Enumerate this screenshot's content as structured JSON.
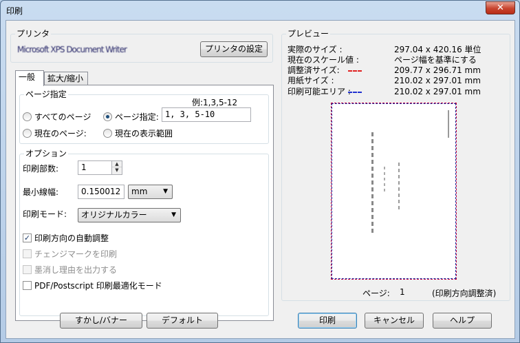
{
  "window": {
    "title": "印刷",
    "close_glyph": "✕"
  },
  "printer": {
    "group_label": "プリンタ",
    "name": "Microsoft XPS Document Writer",
    "settings_button": "プリンタの設定"
  },
  "tabs": [
    {
      "label": "一般",
      "active": true
    },
    {
      "label": "拡大/縮小",
      "active": false
    }
  ],
  "page_range": {
    "group_label": "ページ指定",
    "example": "例:1,3,5-12",
    "all_pages": "すべてのページ",
    "specify": "ページ指定:",
    "specify_value": "1, 3, 5-10",
    "current_page": "現在のページ:",
    "current_view": "現在の表示範囲",
    "selected": "specify"
  },
  "options": {
    "group_label": "オプション",
    "copies_label": "印刷部数:",
    "copies_value": "1",
    "min_line_label": "最小線幅:",
    "min_line_value": "0.150012",
    "min_line_unit": "mm",
    "mode_label": "印刷モード:",
    "mode_value": "オリジナルカラー",
    "auto_orient": "印刷方向の自動調整",
    "change_marks": "チェンジマークを印刷",
    "redaction_reason": "墨消し理由を出力する",
    "pdf_optimize": "PDF/Postscript 印刷最適化モード",
    "check_glyph": "✓"
  },
  "preview": {
    "group_label": "プレビュー",
    "rows": [
      {
        "label": "実際のサイズ :",
        "value": "297.04 x 420.16 単位"
      },
      {
        "label": "現在のスケール値 :",
        "value": "ページ幅を基準にする"
      },
      {
        "label": "調整済サイズ:",
        "value": "209.77 x 296.71 mm"
      },
      {
        "label": "用紙サイズ :",
        "value": "210.02 x 297.01 mm"
      },
      {
        "label": "印刷可能エリア :",
        "value": "210.02 x 297.01 mm"
      }
    ],
    "page_label": "ページ:",
    "page_value": "1",
    "orientation_note": "(印刷方向調整済)",
    "adjusted_color": "#e02020",
    "printable_color": "#2030d0"
  },
  "buttons": {
    "watermark": "すかし/バナー",
    "default": "デフォルト",
    "print": "印刷",
    "cancel": "キャンセル",
    "help": "ヘルプ"
  }
}
